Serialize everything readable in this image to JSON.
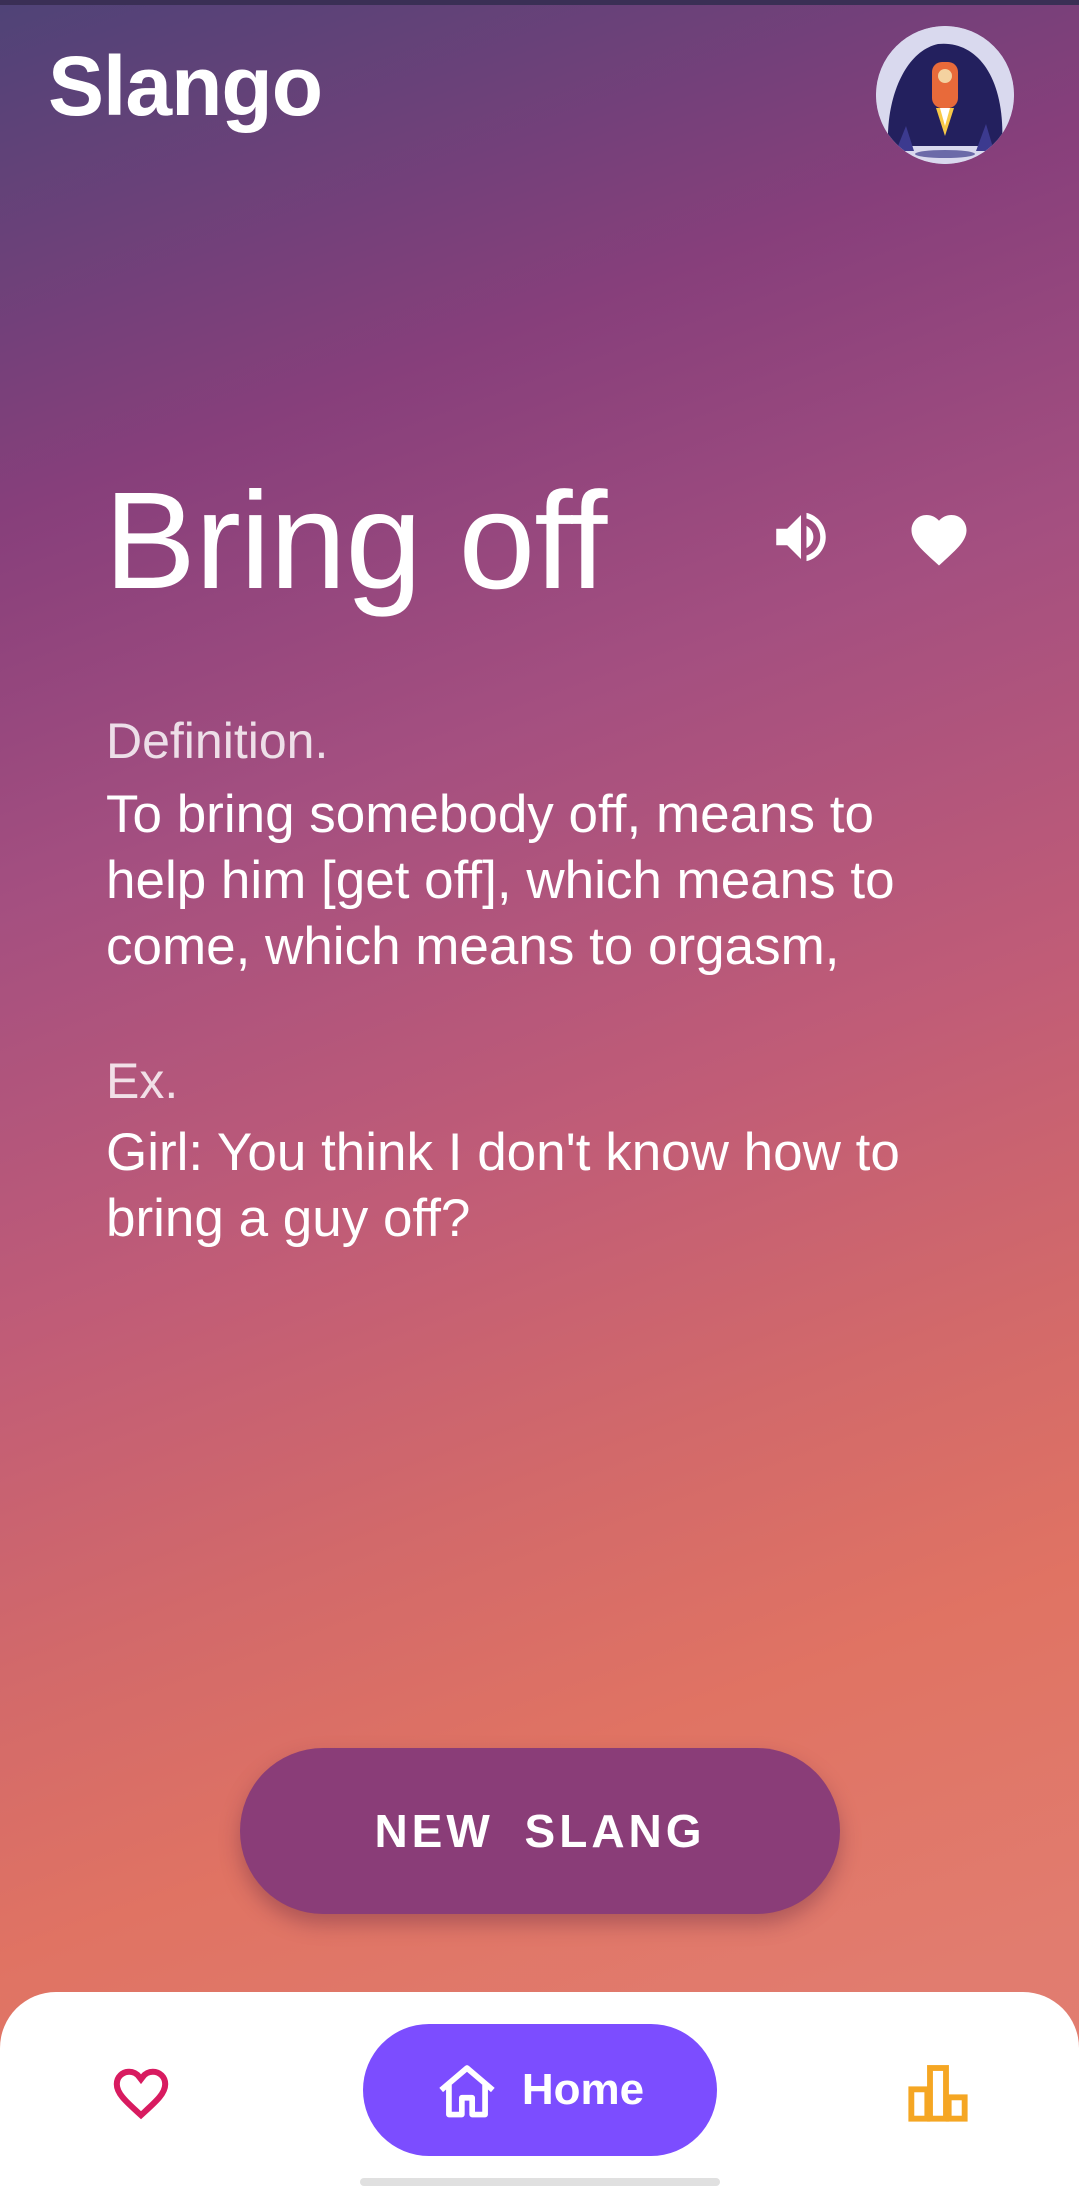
{
  "app": {
    "title": "Slango"
  },
  "word": {
    "text": "Bring off",
    "definition_label": "Definition.",
    "definition": "To bring somebody off, means to help him [get off], which means to come, which means to orgasm,",
    "example_label": "Ex.",
    "example": "Girl: You think I don't know how to bring a guy off?"
  },
  "actions": {
    "new_slang_label": "NEW  SLANG"
  },
  "nav": {
    "home_label": "Home"
  },
  "icons": {
    "speaker": "volume-up-icon",
    "favorite": "heart-icon",
    "nav_favorite": "heart-outline-icon",
    "nav_home": "home-icon",
    "nav_stats": "bar-chart-icon"
  },
  "colors": {
    "new_slang_button": "#8a3d78",
    "nav_home_pill": "#7c4dff",
    "nav_heart": "#d81b60",
    "nav_stats": "#f5a623"
  }
}
